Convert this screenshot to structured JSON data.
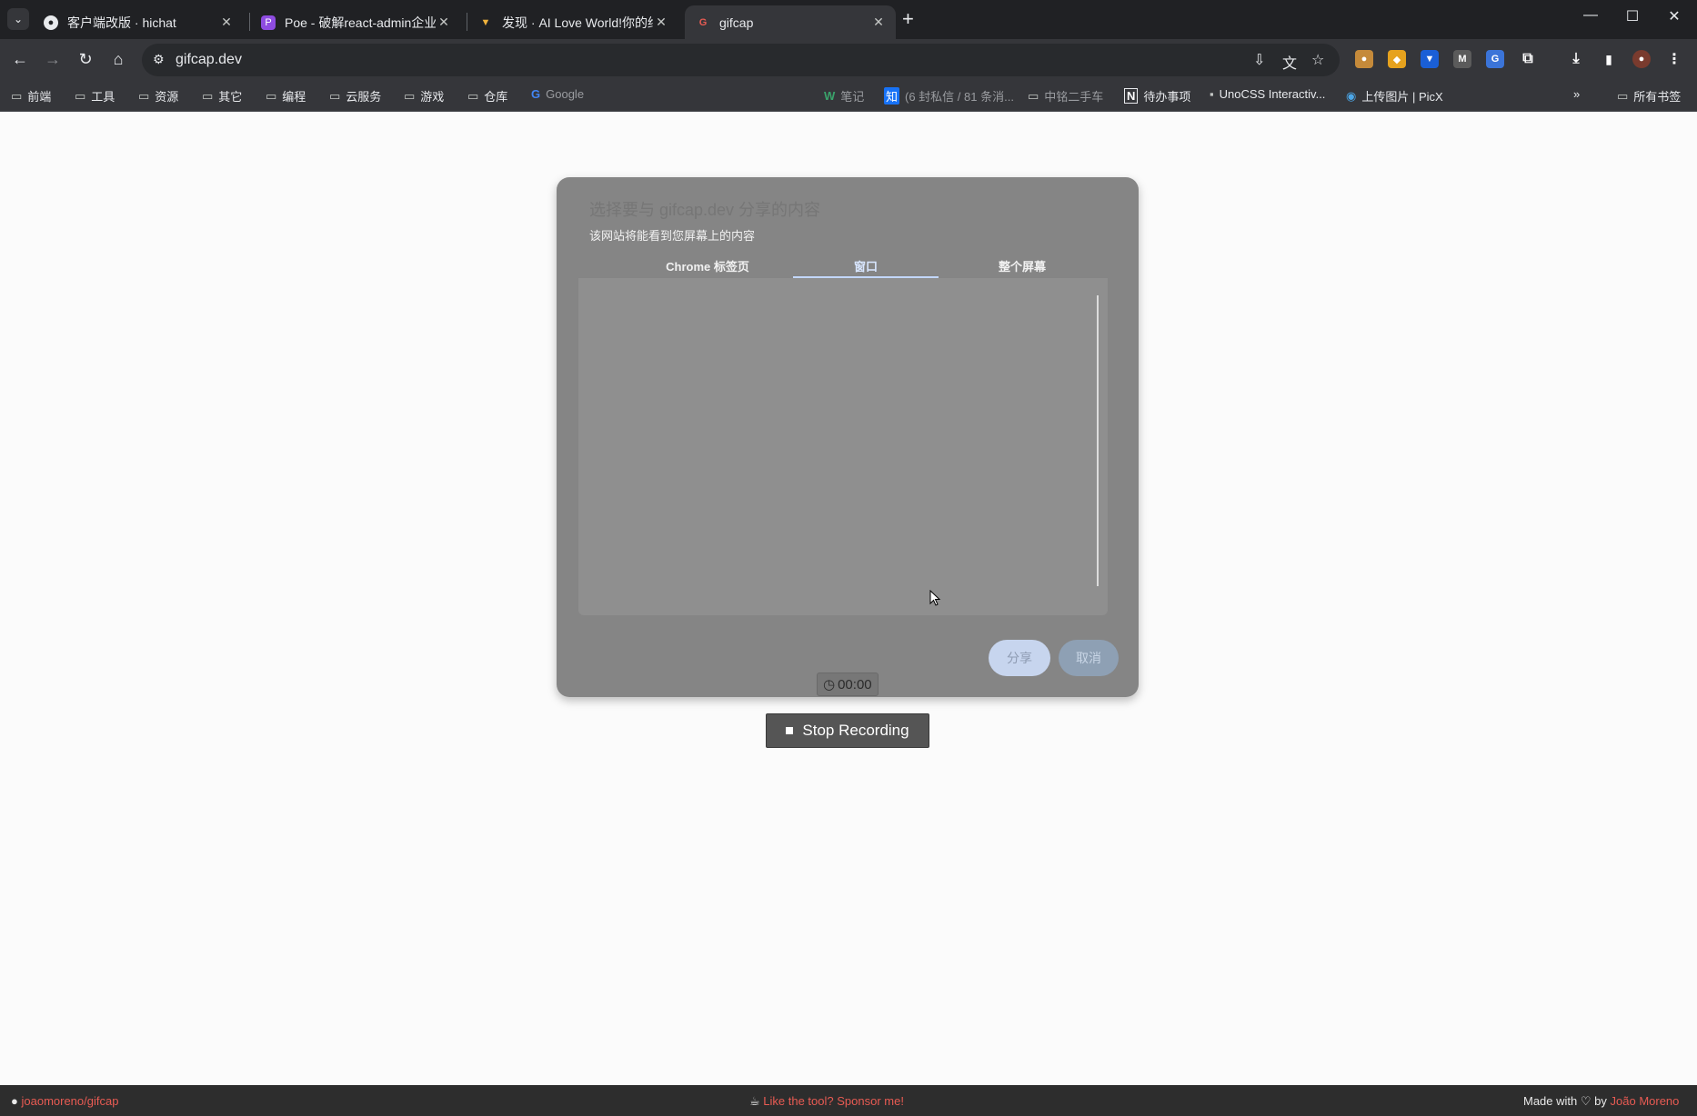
{
  "tabs": [
    {
      "title": "客户端改版 · hichat",
      "favicon": "github-icon",
      "active": false
    },
    {
      "title": "Poe - 破解react-admin企业版",
      "favicon": "poe-icon",
      "active": false
    },
    {
      "title": "发现 · AI Love World!你的终极",
      "favicon": "aiworld-icon",
      "active": false
    },
    {
      "title": "gifcap",
      "favicon": "gifcap-icon",
      "active": true
    }
  ],
  "toolbar": {
    "url": "gifcap.dev"
  },
  "bookmarks": [
    {
      "label": "前端",
      "icon": "folder-icon"
    },
    {
      "label": "工具",
      "icon": "folder-icon"
    },
    {
      "label": "资源",
      "icon": "folder-icon"
    },
    {
      "label": "其它",
      "icon": "folder-icon"
    },
    {
      "label": "编程",
      "icon": "folder-icon"
    },
    {
      "label": "云服务",
      "icon": "folder-icon"
    },
    {
      "label": "游戏",
      "icon": "folder-icon"
    },
    {
      "label": "仓库",
      "icon": "folder-icon"
    },
    {
      "label": "Google",
      "icon": "google-icon"
    },
    {
      "label": "笔记",
      "icon": "wps-icon"
    },
    {
      "label": "(6 封私信 / 81 条消...",
      "icon": "zhihu-icon"
    },
    {
      "label": "中铭二手车",
      "icon": "folder-icon"
    },
    {
      "label": "待办事项",
      "icon": "notion-icon"
    },
    {
      "label": "UnoCSS Interactiv...",
      "icon": "unocss-icon"
    },
    {
      "label": "上传图片 | PicX",
      "icon": "picx-icon"
    }
  ],
  "all_bookmarks": "所有书签",
  "dialog": {
    "title": "选择要与 gifcap.dev 分享的内容",
    "subtitle": "该网站将能看到您屏幕上的内容",
    "tabs": [
      "Chrome 标签页",
      "窗口",
      "整个屏幕"
    ],
    "selected_tab": "窗口",
    "share_label": "分享",
    "cancel_label": "取消"
  },
  "recorder": {
    "timer": "00:00",
    "stop_label": "Stop Recording"
  },
  "footer": {
    "repo": "joaomoreno/gifcap",
    "sponsor": "Like the tool? Sponsor me!",
    "made_with": "Made with",
    "by": "by",
    "author": "João Moreno"
  }
}
